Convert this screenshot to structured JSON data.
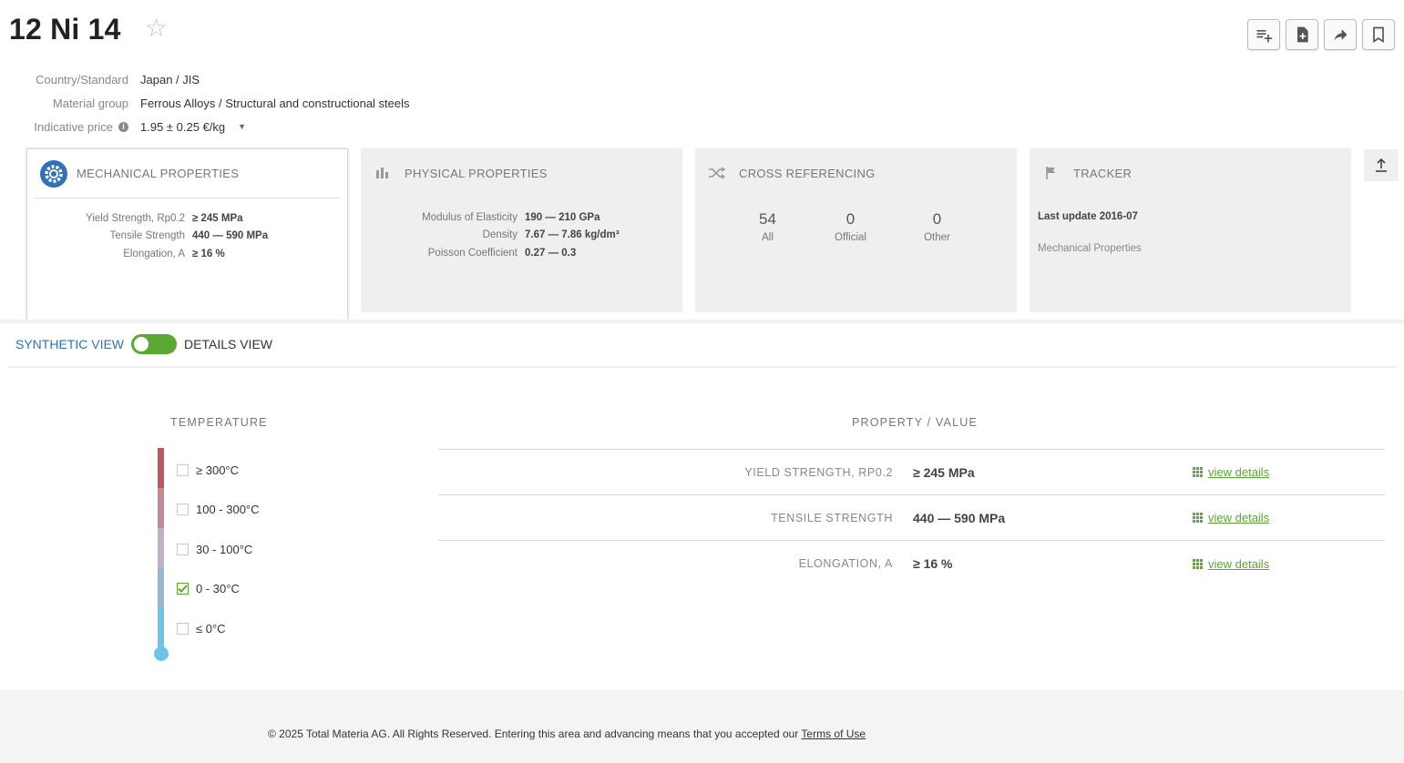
{
  "header": {
    "title": "12 Ni 14",
    "favorite_icon": "star-icon",
    "toolbar": [
      {
        "name": "add-to-list-button",
        "icon": "playlist-add-icon"
      },
      {
        "name": "add-document-button",
        "icon": "document-add-icon"
      },
      {
        "name": "share-button",
        "icon": "share-icon"
      },
      {
        "name": "bookmark-button",
        "icon": "bookmark-icon"
      }
    ]
  },
  "meta": {
    "country_label": "Country/Standard",
    "country_value": "Japan / JIS",
    "group_label": "Material group",
    "group_value": "Ferrous Alloys / Structural and constructional steels",
    "price_label": "Indicative price",
    "price_value": "1.95 ± 0.25 €/kg"
  },
  "cards": {
    "mechanical": {
      "title": "MECHANICAL PROPERTIES",
      "rows": [
        {
          "label": "Yield Strength, Rp0.2",
          "value": "≥ 245 MPa"
        },
        {
          "label": "Tensile Strength",
          "value": "440 — 590 MPa"
        },
        {
          "label": "Elongation, A",
          "value": "≥ 16 %"
        }
      ]
    },
    "physical": {
      "title": "PHYSICAL PROPERTIES",
      "rows": [
        {
          "label": "Modulus of Elasticity",
          "value": "190 — 210 GPa"
        },
        {
          "label": "Density",
          "value": "7.67 — 7.86 kg/dm³"
        },
        {
          "label": "Poisson Coefficient",
          "value": "0.27 — 0.3"
        }
      ]
    },
    "cross": {
      "title": "CROSS REFERENCING",
      "cols": [
        {
          "num": "54",
          "label": "All"
        },
        {
          "num": "0",
          "label": "Official"
        },
        {
          "num": "0",
          "label": "Other"
        }
      ]
    },
    "tracker": {
      "title": "TRACKER",
      "update": "Last update 2016-07",
      "sub": "Mechanical Properties"
    }
  },
  "view_toggle": {
    "left_label": "SYNTHETIC VIEW",
    "right_label": "DETAILS VIEW",
    "state": "synthetic"
  },
  "temperature": {
    "title": "TEMPERATURE",
    "items": [
      {
        "label": "≥ 300°C",
        "checked": false,
        "color": "#b85a5f"
      },
      {
        "label": "100 - 300°C",
        "checked": false,
        "color": "#c48a92"
      },
      {
        "label": "30 - 100°C",
        "checked": false,
        "color": "#bdb3c4"
      },
      {
        "label": "0 - 30°C",
        "checked": true,
        "color": "#98b6cf"
      },
      {
        "label": "≤ 0°C",
        "checked": false,
        "color": "#6ec3ea"
      }
    ]
  },
  "property_value": {
    "title": "PROPERTY / VALUE",
    "rows": [
      {
        "label": "YIELD STRENGTH, RP0.2",
        "value": "≥ 245 MPa",
        "link": "view details"
      },
      {
        "label": "TENSILE STRENGTH",
        "value": "440 — 590 MPa",
        "link": "view details"
      },
      {
        "label": "ELONGATION, A",
        "value": "≥ 16 %",
        "link": "view details"
      }
    ]
  },
  "footer": {
    "text": "© 2025 Total Materia AG. All Rights Reserved. Entering this area and advancing means that you accepted our",
    "link": "Terms of Use"
  },
  "colors": {
    "accent_green": "#5ba832",
    "accent_blue": "#2f73b6"
  }
}
